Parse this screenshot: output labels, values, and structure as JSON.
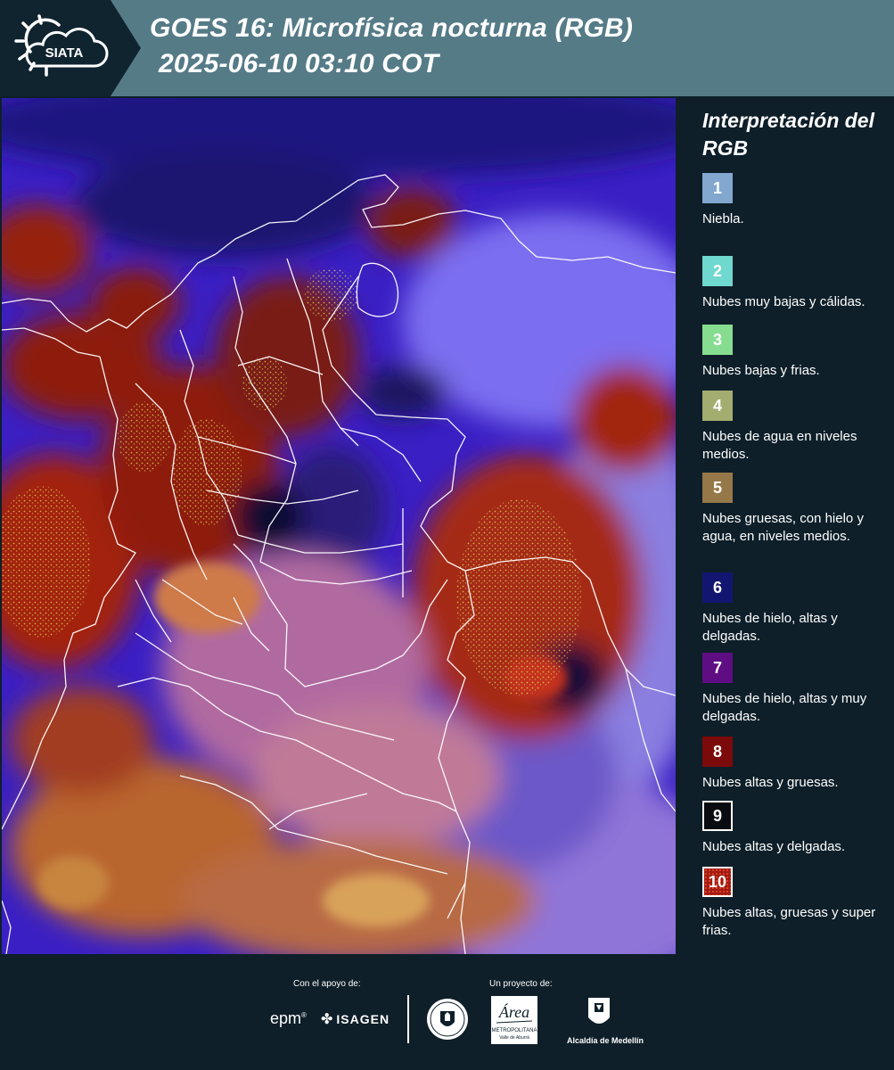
{
  "header": {
    "logo_text": "SIATA",
    "title_line_1": "GOES 16: Microfísica nocturna (RGB)",
    "title_line_2": "2025-06-10 03:10 COT"
  },
  "map": {
    "image": "GOES-16 night microphysics RGB satellite composite over Colombia and northern South America with white political boundaries"
  },
  "legend": {
    "title": "Interpretación del RGB",
    "items": [
      {
        "number": "1",
        "color": "#82a8cf",
        "label": "Niebla."
      },
      {
        "number": "2",
        "color": "#6fd8cf",
        "label": "Nubes muy bajas y cálidas."
      },
      {
        "number": "3",
        "color": "#86dd90",
        "label": "Nubes bajas y frias."
      },
      {
        "number": "4",
        "color": "#a3ad70",
        "label": "Nubes de agua en niveles medios."
      },
      {
        "number": "5",
        "color": "#967748",
        "label": "Nubes gruesas, con hielo y agua, en niveles medios."
      },
      {
        "number": "6",
        "color": "#121671",
        "label": "Nubes de hielo, altas y delgadas."
      },
      {
        "number": "7",
        "color": "#5e0d82",
        "label": "Nubes de hielo, altas y muy delgadas."
      },
      {
        "number": "8",
        "color": "#7b0a0a",
        "label": "Nubes altas y gruesas."
      },
      {
        "number": "9",
        "color": "#0a0b10",
        "label": "Nubes altas y delgadas."
      },
      {
        "number": "10",
        "color": "#a01b10",
        "label": "Nubes altas, gruesas y super frias."
      }
    ]
  },
  "footer": {
    "support_caption": "Con el apoyo de:",
    "project_caption": "Un proyecto de:",
    "epm": "epm",
    "isagen": "ISAGEN",
    "area_text": "Área",
    "area_subtext": "METROPOLITANA",
    "area_subtext_2": "Valle de Aburrá",
    "alcaldia": "Alcaldía de Medellín"
  }
}
